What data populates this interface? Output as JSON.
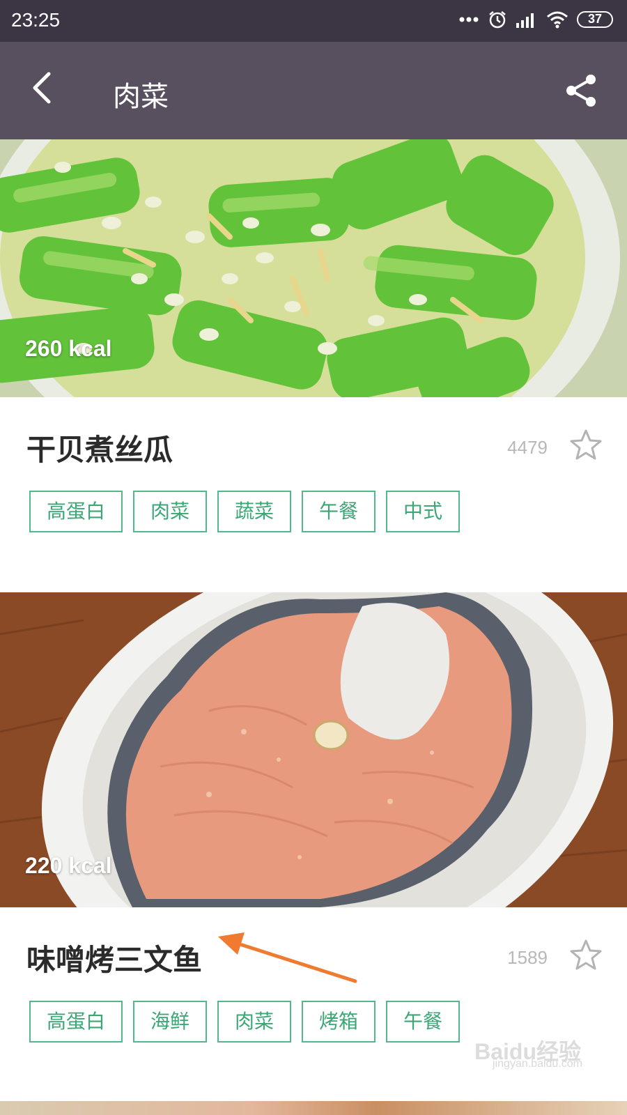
{
  "status_bar": {
    "time": "23:25",
    "battery": "37"
  },
  "header": {
    "title": "肉菜"
  },
  "recipes": [
    {
      "kcal": "260 kcal",
      "name": "干贝煮丝瓜",
      "favorites": "4479",
      "tags": [
        "高蛋白",
        "肉菜",
        "蔬菜",
        "午餐",
        "中式"
      ]
    },
    {
      "kcal": "220 kcal",
      "name": "味噌烤三文鱼",
      "favorites": "1589",
      "tags": [
        "高蛋白",
        "海鲜",
        "肉菜",
        "烤箱",
        "午餐"
      ]
    }
  ],
  "watermark": {
    "logo": "Baidu经验",
    "url": "jingyan.baidu.com"
  },
  "colors": {
    "status_bar": "#3c3644",
    "header": "#58505e",
    "tag_accent": "#52b78a",
    "annotation_arrow": "#f07a2f"
  }
}
